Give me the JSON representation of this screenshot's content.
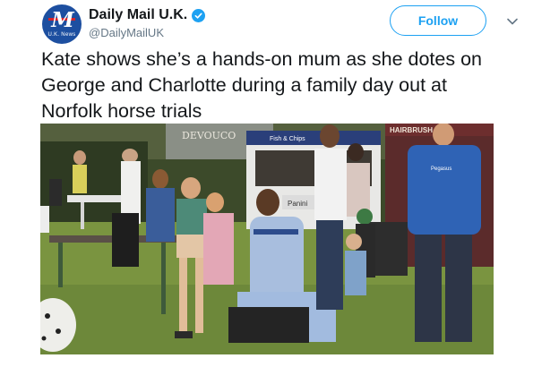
{
  "account": {
    "display_name": "Daily Mail U.K.",
    "handle": "@DailyMailUK",
    "avatar_logo": "M",
    "avatar_sub": "U.K. News",
    "verified_icon": "verified-badge-icon"
  },
  "actions": {
    "follow_label": "Follow",
    "menu_icon": "chevron-down-icon"
  },
  "tweet": {
    "text": "Kate shows she’s a hands-on mum as she dotes on George and Charlotte during a family day out at Norfolk horse trials"
  },
  "photo": {
    "signs": {
      "devoucoux": "DEVOUCO",
      "hairbrush": "HAIRBRUSH",
      "van_banner": "Fish & Chips",
      "panini": "Panini",
      "pegasus": "Pegasus"
    }
  },
  "colors": {
    "accent": "#1da1f2",
    "text": "#14171a",
    "secondary_text": "#657786",
    "avatar_bg": "#1d4fa0"
  }
}
